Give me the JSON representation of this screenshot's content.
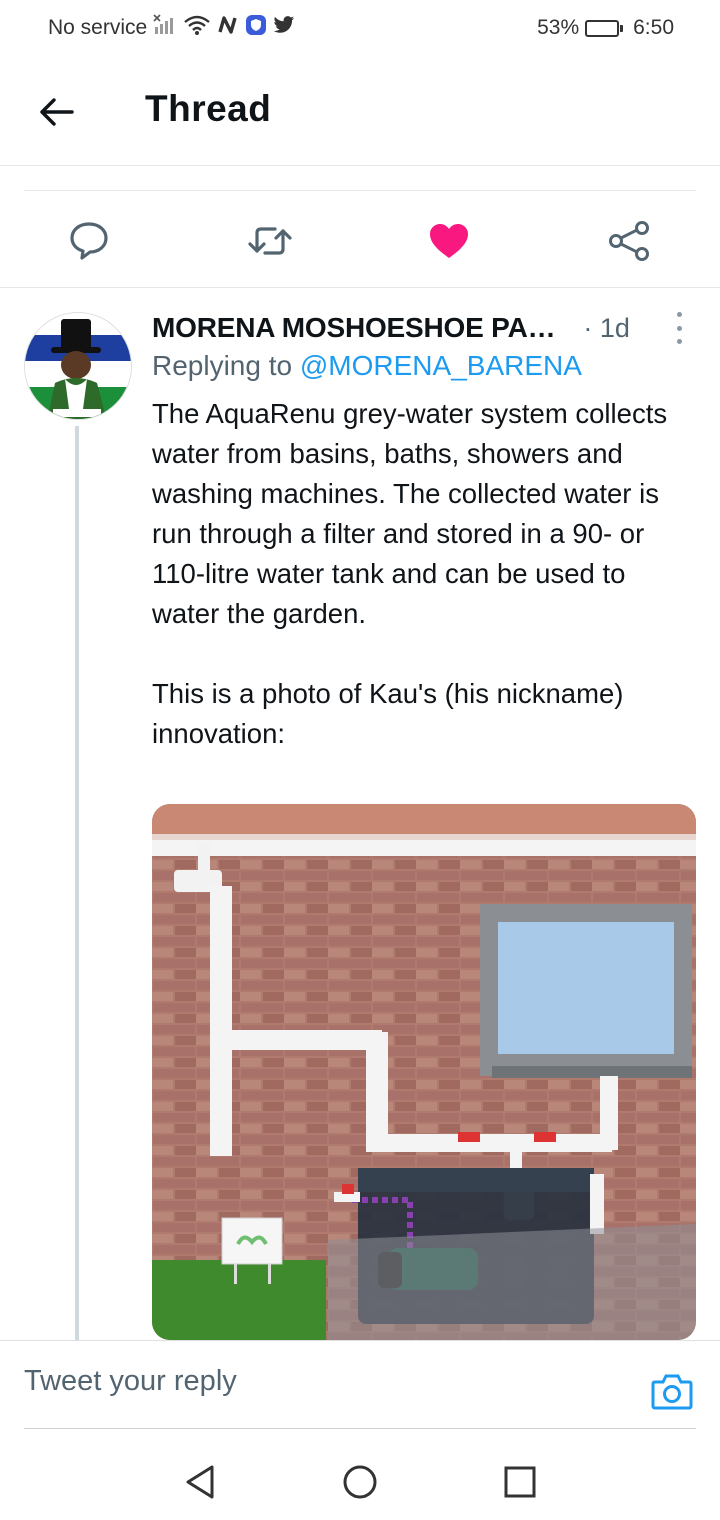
{
  "status_bar": {
    "carrier": "No service",
    "battery": "53%",
    "battery_level": 0.53,
    "time": "6:50"
  },
  "header": {
    "title": "Thread"
  },
  "actions": {
    "reply_icon": "reply-icon",
    "retweet_icon": "retweet-icon",
    "like_icon": "heart-filled-icon",
    "share_icon": "share-icon",
    "like_color": "#f91880"
  },
  "tweet": {
    "author_name": "MORENA MOSHOESHOE PA…",
    "time": "· 1d",
    "replying_prefix": "Replying to ",
    "replying_handle": "@MORENA_BARENA",
    "text_paragraph_1": "The AquaRenu grey-water system collects water from basins, baths, showers and washing machines. The collected water is run through a filter and stored in a 90- or 110-litre water tank and can be used to water the garden.",
    "text_paragraph_2": "This is a photo of Kau's (his nickname) innovation:",
    "accent_color": "#1d9bf0"
  },
  "reply_bar": {
    "placeholder": "Tweet your reply",
    "camera_icon": "camera-icon"
  },
  "nav_bar": {
    "back": "nav-back-icon",
    "home": "nav-home-icon",
    "recents": "nav-recents-icon"
  }
}
